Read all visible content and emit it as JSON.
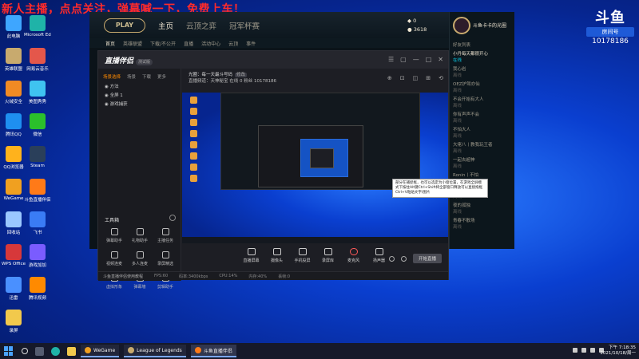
{
  "banner": "新人主播，点点关注，弹幕喊一下，免费上车！",
  "desktop_icons": [
    {
      "label": "此电脑",
      "color": "#3ea6ff"
    },
    {
      "label": "Microsoft Edge",
      "color": "#1fb3a8"
    },
    {
      "label": "英雄联盟",
      "color": "#c8aa6e"
    },
    {
      "label": "网易云音乐",
      "color": "#e4574b"
    },
    {
      "label": "火绒安全",
      "color": "#f08a24"
    },
    {
      "label": "美图秀秀",
      "color": "#3fc3f0"
    },
    {
      "label": "腾讯QQ",
      "color": "#1e8ff0"
    },
    {
      "label": "微信",
      "color": "#2bc02b"
    },
    {
      "label": "QQ浏览器",
      "color": "#ffb21c"
    },
    {
      "label": "Steam",
      "color": "#2a3f5a"
    },
    {
      "label": "WeGame",
      "color": "#f0a020"
    },
    {
      "label": "斗鱼直播伴侣",
      "color": "#ff7a18"
    },
    {
      "label": "回收站",
      "color": "#9ac7ff"
    },
    {
      "label": "飞书",
      "color": "#3a7cf5"
    },
    {
      "label": "WPS Office",
      "color": "#d7383a"
    },
    {
      "label": "游戏加加",
      "color": "#7a5cff"
    },
    {
      "label": "迅雷",
      "color": "#4a90ff"
    },
    {
      "label": "腾讯视频",
      "color": "#ff8a00"
    },
    {
      "label": "录屏",
      "color": "#f2c94c"
    }
  ],
  "douyu": {
    "mark": "斗鱼",
    "room_label": "房间号",
    "room_number": "10178186"
  },
  "lol": {
    "play": "PLAY",
    "tabs": [
      "主页",
      "云顶之弈",
      "冠军杯赛"
    ],
    "currency1": "0",
    "currency2": "3618",
    "subnav": [
      "首页",
      "英雄联盟",
      "下载/不公开",
      "直播",
      "活动中心",
      "云顶",
      "事件"
    ],
    "profile_name": "斗鱼卡卡的光圈",
    "friends_header": "好友列表",
    "friends": [
      {
        "name": "小丹每天都很开心",
        "status": "在线",
        "on": true
      },
      {
        "name": "我心岩",
        "status": "离线",
        "on": false
      },
      {
        "name": "OEZ护驾亦仙",
        "status": "离线",
        "on": false
      },
      {
        "name": "不会开始有大人",
        "status": "离线",
        "on": false
      },
      {
        "name": "你有声声不会",
        "status": "离线",
        "on": false
      },
      {
        "name": "不怕大人",
        "status": "离线",
        "on": false
      },
      {
        "name": "大佬八丨教我玩王者",
        "status": "离线",
        "on": false
      },
      {
        "name": "一起去超神",
        "status": "离线",
        "on": false
      },
      {
        "name": "Ronin丨不怕",
        "status": "离线",
        "on": false
      },
      {
        "name": "暗影刺客",
        "status": "离线",
        "on": false
      },
      {
        "name": "夜的孤独",
        "status": "离线",
        "on": false
      },
      {
        "name": "青春不散场",
        "status": "离线",
        "on": false
      }
    ]
  },
  "assistant": {
    "logo": "直播伴侣",
    "logo_tag": "测试版",
    "window_buttons": [
      "☰",
      "▢",
      "—",
      "□",
      "✕"
    ],
    "scene_tabs": [
      "场景选择",
      "场景",
      "下载",
      "更多"
    ],
    "sources": [
      "方法",
      "全屏 1",
      "游戏捕获"
    ],
    "tools_header": "工具箱",
    "tools": [
      "弹幕助手",
      "礼物助手",
      "主播任务",
      "视频连麦",
      "多人连麦",
      "录屏精选",
      "虚拟形象",
      "弹幕墙",
      "剪辑助手"
    ],
    "room_line1": "光圈：每一天最斗号码",
    "room_tag": "修改",
    "room_line2": "直播频道：天神秘宝  在线 0  粉丝 10178186",
    "room_icons": [
      "⊕",
      "⊡",
      "◫",
      "⊞",
      "⟲"
    ],
    "controls": [
      "直播屏幕",
      "摄像头",
      "手机投屏",
      "录屏库",
      "麦克风",
      "扬声器"
    ],
    "start_label": "开始直播",
    "status_items": [
      "斗鱼直播伴侣使用教程",
      "FPS:60",
      "码率:3400kbps",
      "CPU:14%",
      "内存:40%",
      "丢帧:0"
    ],
    "tooltip": "部分在捕捉框，也可以选定为小窗位置，在游戏全屏模式下按住Alt键Ctrl+Shift将全部窗口释放可以直接拖框 Ctrl+V粘贴文字/图片"
  },
  "taskbar": {
    "apps": [
      "WeGame",
      "League of Legends",
      "斗鱼直播伴侣"
    ],
    "time": "下午 7:18:35",
    "date": "2021/10/18/周一"
  }
}
